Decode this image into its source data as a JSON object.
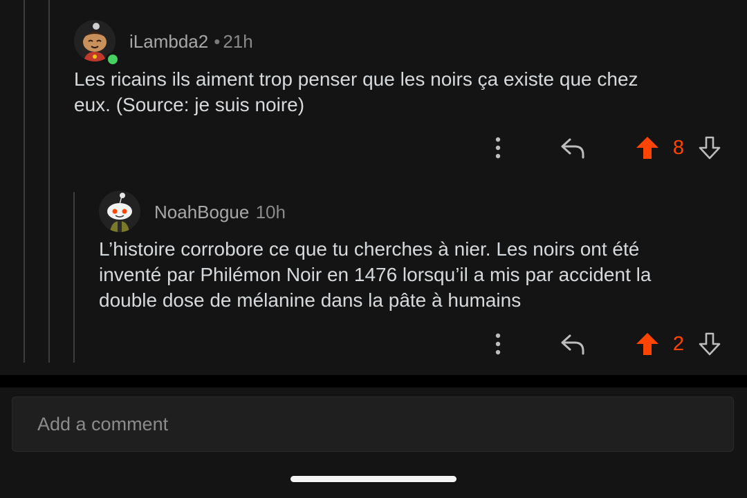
{
  "comments": [
    {
      "username": "iLambda2",
      "separator": "•",
      "time": "21h",
      "body": "Les ricains ils aiment trop penser que les noirs ça existe que chez\neux. (Source: je suis noire)",
      "votes": "8",
      "online": true
    },
    {
      "username": "NoahBogue",
      "time": "10h",
      "body": "L’histoire corrobore ce que tu cherches à nier. Les noirs ont été\ninventé par Philémon Noir en 1476 lorsqu’il a mis par accident la\ndouble dose de mélanine dans la pâte à humains",
      "votes": "2",
      "online": false
    }
  ],
  "input": {
    "placeholder": "Add a comment"
  },
  "colors": {
    "accent_upvote": "#ff4500",
    "online": "#46d160",
    "background": "#141414"
  },
  "icons": [
    "more-vertical-icon",
    "reply-icon",
    "upvote-arrow-icon",
    "downvote-arrow-icon"
  ]
}
